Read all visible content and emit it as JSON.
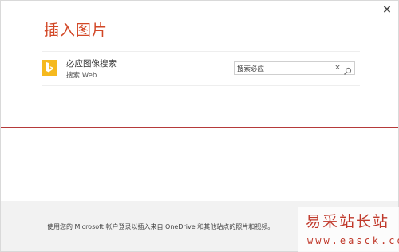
{
  "dialog": {
    "title": "插入图片",
    "close_label": "×"
  },
  "source": {
    "name": "必应图像搜索",
    "sub": "搜索 Web",
    "icon": "bing-icon",
    "brand_color": "#f5b91e"
  },
  "search": {
    "value": "搜索必应",
    "clear_label": "×",
    "icon": "search-icon"
  },
  "footer": {
    "text": "使用您的 Microsoft 帐户登录以插入来自 OneDrive 和其他站点的照片和视频。"
  },
  "watermark": {
    "cn": "易采站长站",
    "url": "www.easck.com"
  },
  "colors": {
    "accent": "#d24726",
    "divider": "#b53a3a",
    "footer_bg": "#f2f2f2"
  }
}
